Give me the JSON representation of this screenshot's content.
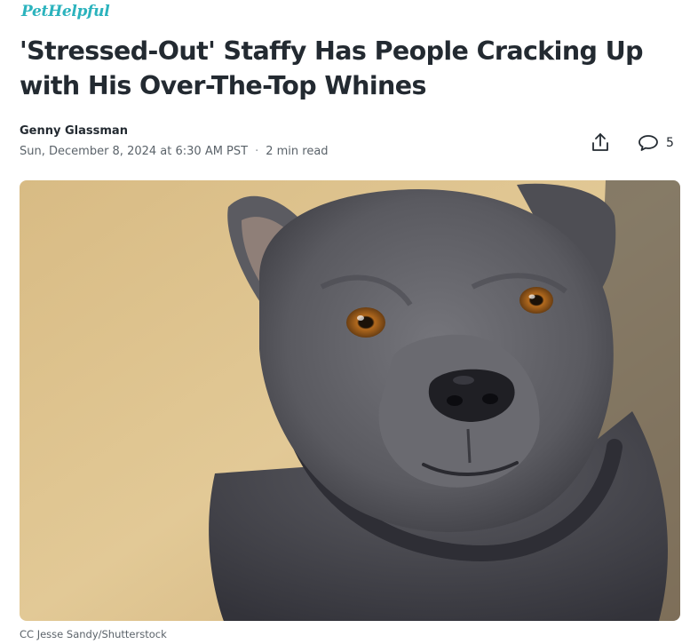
{
  "brand": {
    "name": "PetHelpful"
  },
  "article": {
    "headline": "'Stressed-Out' Staffy Has People Cracking Up with His Over-The-Top Whines",
    "author": "Genny Glassman",
    "date": "Sun, December 8, 2024 at 6:30 AM PST",
    "read_time": "2 min read",
    "separator": "·"
  },
  "actions": {
    "share_icon": "share-icon",
    "comment_icon": "comment-icon",
    "comment_count": "5"
  },
  "image": {
    "caption": "CC Jesse Sandy/Shutterstock",
    "subject": "dog-photo"
  },
  "colors": {
    "brand": "#2bb3bd",
    "text": "#232a31",
    "muted": "#5b636a",
    "sand": "#d9bd8a",
    "dog": "#5f5f64"
  }
}
